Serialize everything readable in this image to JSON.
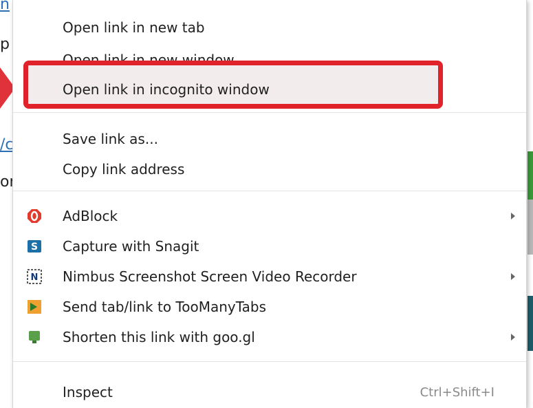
{
  "background": {
    "frag_1": "n",
    "frag_2": "p",
    "frag_3": "/c",
    "frag_4": "or"
  },
  "menu": {
    "groups": [
      {
        "items": [
          {
            "label": "Open link in new tab"
          },
          {
            "label": "Open link in new window"
          },
          {
            "label": "Open link in incognito window",
            "highlighted": true
          }
        ]
      },
      {
        "items": [
          {
            "label": "Save link as..."
          },
          {
            "label": "Copy link address"
          }
        ]
      },
      {
        "items": [
          {
            "label": "AdBlock",
            "icon": "adblock-icon",
            "submenu": true
          },
          {
            "label": "Capture with Snagit",
            "icon": "snagit-icon"
          },
          {
            "label": "Nimbus Screenshot  Screen Video Recorder",
            "icon": "nimbus-icon",
            "submenu": true
          },
          {
            "label": "Send tab/link to TooManyTabs",
            "icon": "toomanytabs-icon"
          },
          {
            "label": "Shorten this link with goo.gl",
            "icon": "googl-icon",
            "submenu": true
          }
        ]
      },
      {
        "items": [
          {
            "label": "Inspect",
            "shortcut": "Ctrl+Shift+I"
          }
        ]
      }
    ]
  },
  "annotation_color": "#e0222b"
}
